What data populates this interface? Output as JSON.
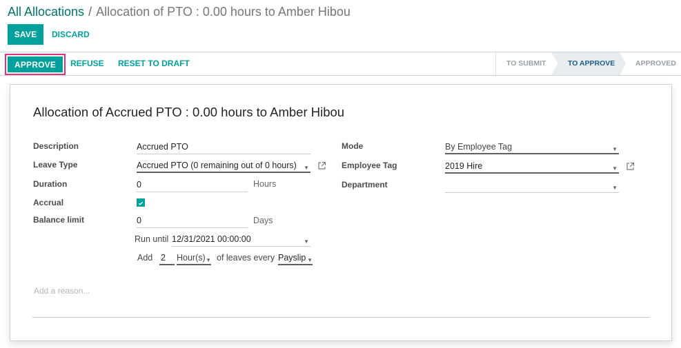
{
  "breadcrumb": {
    "parent": "All Allocations",
    "separator": "/",
    "current": "Allocation of PTO : 0.00 hours to Amber Hibou"
  },
  "toolbar": {
    "save_label": "SAVE",
    "discard_label": "DISCARD"
  },
  "statusbar": {
    "approve_label": "APPROVE",
    "refuse_label": "REFUSE",
    "reset_label": "RESET TO DRAFT",
    "stages": [
      {
        "label": "TO SUBMIT",
        "active": false
      },
      {
        "label": "TO APPROVE",
        "active": true
      },
      {
        "label": "APPROVED",
        "active": false
      }
    ],
    "highlight_color": "#e0307a"
  },
  "form": {
    "title": "Allocation of Accrued PTO : 0.00 hours to Amber Hibou",
    "left": {
      "description_label": "Description",
      "description_value": "Accrued PTO",
      "leave_type_label": "Leave Type",
      "leave_type_value": "Accrued PTO (0 remaining out of 0 hours)",
      "duration_label": "Duration",
      "duration_value": "0",
      "duration_unit": "Hours",
      "accrual_label": "Accrual",
      "accrual_checked": true,
      "balance_limit_label": "Balance limit",
      "balance_limit_value": "0",
      "balance_limit_unit": "Days",
      "run_until_label": "Run until",
      "run_until_value": "12/31/2021 00:00:00",
      "add_label": "Add",
      "add_value": "2",
      "add_unit": "Hour(s)",
      "leaves_every_label": "of leaves every",
      "leaves_every_value": "Payslip"
    },
    "right": {
      "mode_label": "Mode",
      "mode_value": "By Employee Tag",
      "employee_tag_label": "Employee Tag",
      "employee_tag_value": "2019 Hire",
      "department_label": "Department",
      "department_value": ""
    },
    "reason_placeholder": "Add a reason..."
  },
  "colors": {
    "primary": "#00a09d",
    "breadcrumb_link": "#00736b",
    "active_stage": "#1d5e87"
  }
}
